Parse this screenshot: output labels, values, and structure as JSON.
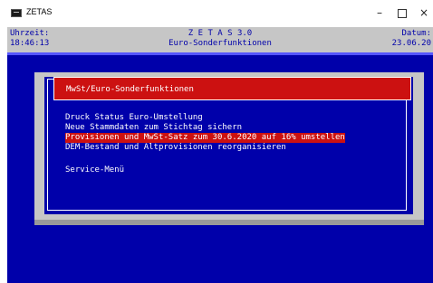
{
  "window": {
    "title": "ZETAS",
    "minimize_symbol": "–",
    "close_symbol": "×"
  },
  "header": {
    "time_label": "Uhrzeit:",
    "time_value": "18:46:13",
    "app_name": "Z E T A S 3.0",
    "subtitle": "Euro-Sonderfunktionen",
    "date_label": "Datum:",
    "date_value": "23.06.20"
  },
  "dialog": {
    "title": "MwSt/Euro-Sonderfunktionen",
    "items": [
      "Druck Status Euro-Umstellung",
      "Neue Stammdaten zum Stichtag sichern",
      "Provisionen und MwSt-Satz zum 30.6.2020 auf 16% umstellen",
      "DEM-Bestand und Altprovisionen reorganisieren",
      "Service-Menü"
    ],
    "selected_index": 2
  },
  "colors": {
    "terminal_bg": "#0000aa",
    "header_bg": "#c6c6c6",
    "highlight": "#cc1111",
    "text": "#ffffff"
  }
}
